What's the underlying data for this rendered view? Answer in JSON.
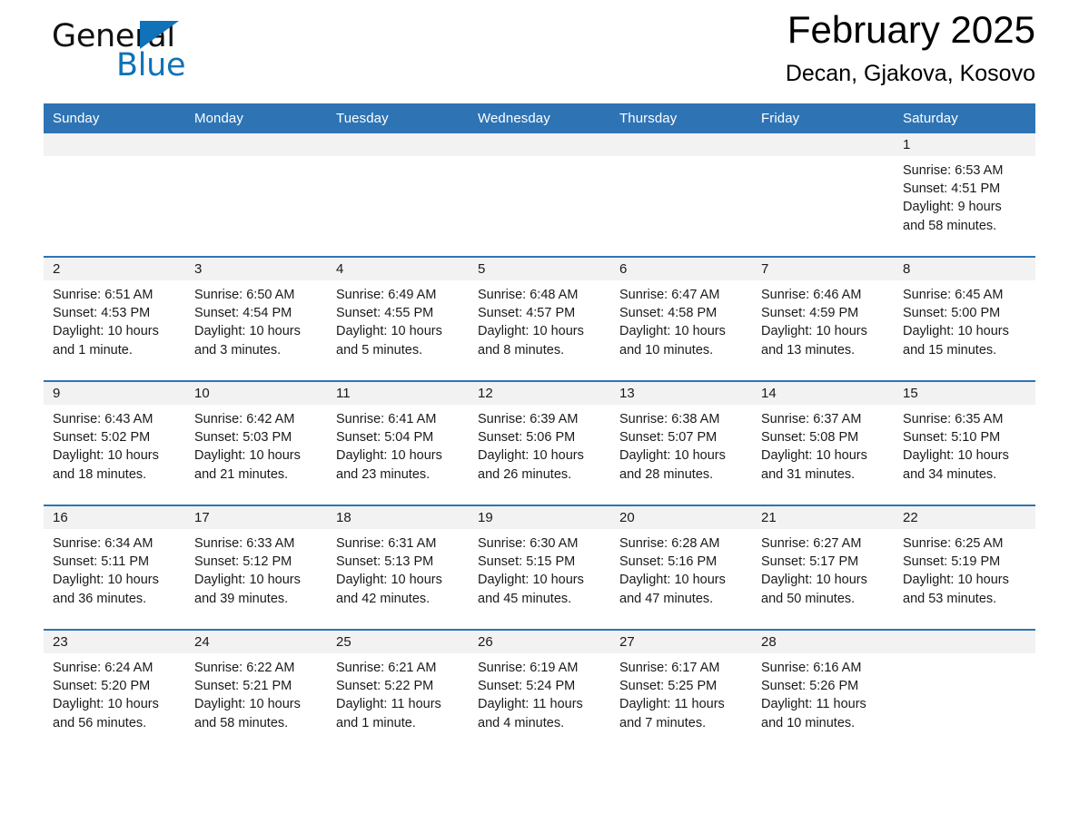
{
  "brand": {
    "name_dark": "General",
    "name_light": "Blue",
    "triangle_color": "#1072b8"
  },
  "header": {
    "title": "February 2025",
    "subtitle": "Decan, Gjakova, Kosovo"
  },
  "theme": {
    "header_blue": "#2e74b5",
    "daynum_band": "#f2f2f2",
    "text": "#1a1a1a"
  },
  "calendar": {
    "weekday_headers": [
      "Sunday",
      "Monday",
      "Tuesday",
      "Wednesday",
      "Thursday",
      "Friday",
      "Saturday"
    ],
    "labels": {
      "sunrise": "Sunrise:",
      "sunset": "Sunset:",
      "daylight": "Daylight:"
    },
    "weeks": [
      [
        {
          "day": "",
          "lines": []
        },
        {
          "day": "",
          "lines": []
        },
        {
          "day": "",
          "lines": []
        },
        {
          "day": "",
          "lines": []
        },
        {
          "day": "",
          "lines": []
        },
        {
          "day": "",
          "lines": []
        },
        {
          "day": "1",
          "lines": [
            "Sunrise: 6:53 AM",
            "Sunset: 4:51 PM",
            "Daylight: 9 hours",
            "and 58 minutes."
          ]
        }
      ],
      [
        {
          "day": "2",
          "lines": [
            "Sunrise: 6:51 AM",
            "Sunset: 4:53 PM",
            "Daylight: 10 hours",
            "and 1 minute."
          ]
        },
        {
          "day": "3",
          "lines": [
            "Sunrise: 6:50 AM",
            "Sunset: 4:54 PM",
            "Daylight: 10 hours",
            "and 3 minutes."
          ]
        },
        {
          "day": "4",
          "lines": [
            "Sunrise: 6:49 AM",
            "Sunset: 4:55 PM",
            "Daylight: 10 hours",
            "and 5 minutes."
          ]
        },
        {
          "day": "5",
          "lines": [
            "Sunrise: 6:48 AM",
            "Sunset: 4:57 PM",
            "Daylight: 10 hours",
            "and 8 minutes."
          ]
        },
        {
          "day": "6",
          "lines": [
            "Sunrise: 6:47 AM",
            "Sunset: 4:58 PM",
            "Daylight: 10 hours",
            "and 10 minutes."
          ]
        },
        {
          "day": "7",
          "lines": [
            "Sunrise: 6:46 AM",
            "Sunset: 4:59 PM",
            "Daylight: 10 hours",
            "and 13 minutes."
          ]
        },
        {
          "day": "8",
          "lines": [
            "Sunrise: 6:45 AM",
            "Sunset: 5:00 PM",
            "Daylight: 10 hours",
            "and 15 minutes."
          ]
        }
      ],
      [
        {
          "day": "9",
          "lines": [
            "Sunrise: 6:43 AM",
            "Sunset: 5:02 PM",
            "Daylight: 10 hours",
            "and 18 minutes."
          ]
        },
        {
          "day": "10",
          "lines": [
            "Sunrise: 6:42 AM",
            "Sunset: 5:03 PM",
            "Daylight: 10 hours",
            "and 21 minutes."
          ]
        },
        {
          "day": "11",
          "lines": [
            "Sunrise: 6:41 AM",
            "Sunset: 5:04 PM",
            "Daylight: 10 hours",
            "and 23 minutes."
          ]
        },
        {
          "day": "12",
          "lines": [
            "Sunrise: 6:39 AM",
            "Sunset: 5:06 PM",
            "Daylight: 10 hours",
            "and 26 minutes."
          ]
        },
        {
          "day": "13",
          "lines": [
            "Sunrise: 6:38 AM",
            "Sunset: 5:07 PM",
            "Daylight: 10 hours",
            "and 28 minutes."
          ]
        },
        {
          "day": "14",
          "lines": [
            "Sunrise: 6:37 AM",
            "Sunset: 5:08 PM",
            "Daylight: 10 hours",
            "and 31 minutes."
          ]
        },
        {
          "day": "15",
          "lines": [
            "Sunrise: 6:35 AM",
            "Sunset: 5:10 PM",
            "Daylight: 10 hours",
            "and 34 minutes."
          ]
        }
      ],
      [
        {
          "day": "16",
          "lines": [
            "Sunrise: 6:34 AM",
            "Sunset: 5:11 PM",
            "Daylight: 10 hours",
            "and 36 minutes."
          ]
        },
        {
          "day": "17",
          "lines": [
            "Sunrise: 6:33 AM",
            "Sunset: 5:12 PM",
            "Daylight: 10 hours",
            "and 39 minutes."
          ]
        },
        {
          "day": "18",
          "lines": [
            "Sunrise: 6:31 AM",
            "Sunset: 5:13 PM",
            "Daylight: 10 hours",
            "and 42 minutes."
          ]
        },
        {
          "day": "19",
          "lines": [
            "Sunrise: 6:30 AM",
            "Sunset: 5:15 PM",
            "Daylight: 10 hours",
            "and 45 minutes."
          ]
        },
        {
          "day": "20",
          "lines": [
            "Sunrise: 6:28 AM",
            "Sunset: 5:16 PM",
            "Daylight: 10 hours",
            "and 47 minutes."
          ]
        },
        {
          "day": "21",
          "lines": [
            "Sunrise: 6:27 AM",
            "Sunset: 5:17 PM",
            "Daylight: 10 hours",
            "and 50 minutes."
          ]
        },
        {
          "day": "22",
          "lines": [
            "Sunrise: 6:25 AM",
            "Sunset: 5:19 PM",
            "Daylight: 10 hours",
            "and 53 minutes."
          ]
        }
      ],
      [
        {
          "day": "23",
          "lines": [
            "Sunrise: 6:24 AM",
            "Sunset: 5:20 PM",
            "Daylight: 10 hours",
            "and 56 minutes."
          ]
        },
        {
          "day": "24",
          "lines": [
            "Sunrise: 6:22 AM",
            "Sunset: 5:21 PM",
            "Daylight: 10 hours",
            "and 58 minutes."
          ]
        },
        {
          "day": "25",
          "lines": [
            "Sunrise: 6:21 AM",
            "Sunset: 5:22 PM",
            "Daylight: 11 hours",
            "and 1 minute."
          ]
        },
        {
          "day": "26",
          "lines": [
            "Sunrise: 6:19 AM",
            "Sunset: 5:24 PM",
            "Daylight: 11 hours",
            "and 4 minutes."
          ]
        },
        {
          "day": "27",
          "lines": [
            "Sunrise: 6:17 AM",
            "Sunset: 5:25 PM",
            "Daylight: 11 hours",
            "and 7 minutes."
          ]
        },
        {
          "day": "28",
          "lines": [
            "Sunrise: 6:16 AM",
            "Sunset: 5:26 PM",
            "Daylight: 11 hours",
            "and 10 minutes."
          ]
        },
        {
          "day": "",
          "lines": []
        }
      ]
    ]
  }
}
